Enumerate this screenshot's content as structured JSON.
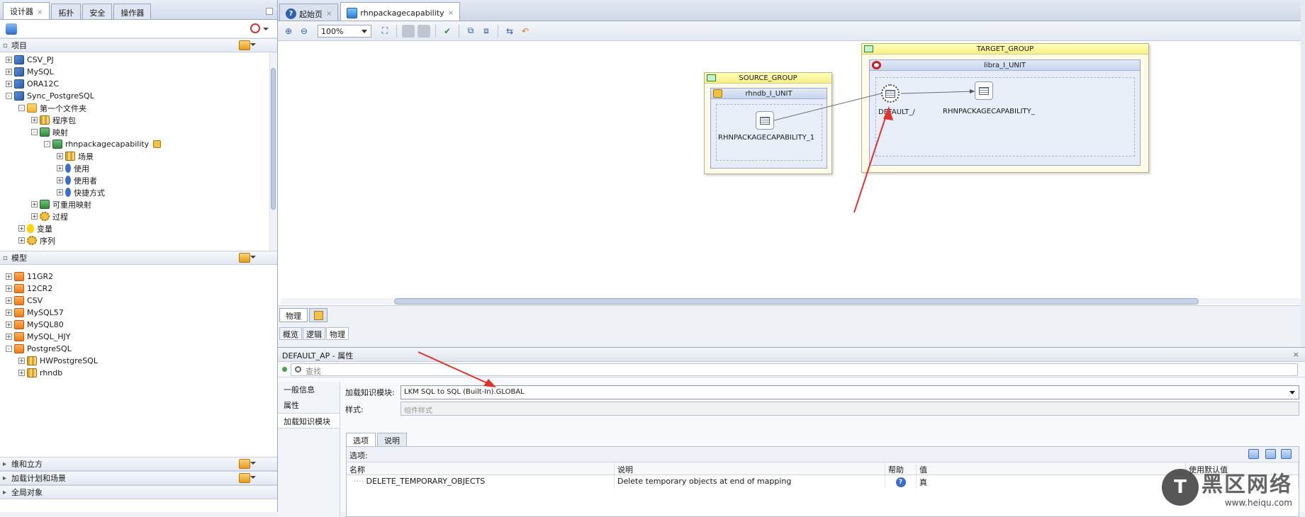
{
  "left_panel": {
    "tabs": [
      "设计器",
      "拓扑",
      "安全",
      "操作器"
    ],
    "section_project": "项目",
    "project_tree": [
      {
        "label": "CSV_PJ",
        "indent": 0,
        "icon": "db",
        "expander": "+"
      },
      {
        "label": "MySQL",
        "indent": 0,
        "icon": "db",
        "expander": "+"
      },
      {
        "label": "ORA12C",
        "indent": 0,
        "icon": "db",
        "expander": "+"
      },
      {
        "label": "Sync_PostgreSQL",
        "indent": 0,
        "icon": "db",
        "expander": "-"
      },
      {
        "label": "第一个文件夹",
        "indent": 1,
        "icon": "fold",
        "expander": "-"
      },
      {
        "label": "程序包",
        "indent": 2,
        "icon": "grid",
        "expander": "+"
      },
      {
        "label": "映射",
        "indent": 2,
        "icon": "map",
        "expander": "-"
      },
      {
        "label": "rhnpackagecapability",
        "indent": 3,
        "icon": "map",
        "expander": "-",
        "locked": true
      },
      {
        "label": "场景",
        "indent": 4,
        "icon": "grid",
        "expander": "+"
      },
      {
        "label": "使用",
        "indent": 4,
        "icon": "pin",
        "expander": "+"
      },
      {
        "label": "使用者",
        "indent": 4,
        "icon": "pin",
        "expander": "+"
      },
      {
        "label": "快捷方式",
        "indent": 4,
        "icon": "pin",
        "expander": "+"
      },
      {
        "label": "可重用映射",
        "indent": 2,
        "icon": "map",
        "expander": "+"
      },
      {
        "label": "过程",
        "indent": 2,
        "icon": "gear",
        "expander": "+"
      },
      {
        "label": "变量",
        "indent": 1,
        "icon": "bulb",
        "expander": "+"
      },
      {
        "label": "序列",
        "indent": 1,
        "icon": "gear",
        "expander": "+"
      }
    ],
    "section_model": "模型",
    "model_tree": [
      {
        "label": "11GR2",
        "indent": 0,
        "icon": "orange",
        "expander": "+"
      },
      {
        "label": "12CR2",
        "indent": 0,
        "icon": "orange",
        "expander": "+"
      },
      {
        "label": "CSV",
        "indent": 0,
        "icon": "orange",
        "expander": "+"
      },
      {
        "label": "MySQL57",
        "indent": 0,
        "icon": "orange",
        "expander": "+"
      },
      {
        "label": "MySQL80",
        "indent": 0,
        "icon": "orange",
        "expander": "+"
      },
      {
        "label": "MySQL_HJY",
        "indent": 0,
        "icon": "orange",
        "expander": "+"
      },
      {
        "label": "PostgreSQL",
        "indent": 0,
        "icon": "orange",
        "expander": "-"
      },
      {
        "label": "HWPostgreSQL",
        "indent": 1,
        "icon": "grid",
        "expander": "+"
      },
      {
        "label": "rhndb",
        "indent": 1,
        "icon": "grid",
        "expander": "+"
      }
    ],
    "bottom_sections": [
      "维和立方",
      "加载计划和场景",
      "全局对象"
    ]
  },
  "editor": {
    "tabs": [
      {
        "label": "起始页",
        "icon": "help-icon"
      },
      {
        "label": "rhnpackagecapability",
        "icon": "mapping-icon"
      }
    ],
    "zoom": "100%",
    "diagram": {
      "target_group": "TARGET_GROUP",
      "source_group": "SOURCE_GROUP",
      "source_unit": "rhndb_I_UNIT",
      "target_unit": "libra_I_UNIT",
      "source_node": "RHNPACKAGECAPABILITY_1",
      "ap_node": "DEFAULT_/",
      "target_node": "RHNPACKAGECAPABILITY_"
    },
    "bottom_tabs": [
      "物理"
    ],
    "sub_tabs": [
      "概览",
      "逻辑",
      "物理"
    ]
  },
  "properties": {
    "title": "DEFAULT_AP - 属性",
    "search_placeholder": "查找",
    "nav": [
      "一般信息",
      "属性",
      "加载知识模块"
    ],
    "lkm_label": "加载知识模块:",
    "lkm_value": "LKM SQL to SQL (Built-In).GLOBAL",
    "style_label": "样式:",
    "style_placeholder": "组件样式",
    "inner_tabs": [
      "选项",
      "说明"
    ],
    "options_label": "选项:",
    "columns": [
      "名称",
      "说明",
      "帮助",
      "值",
      "使用默认值"
    ],
    "rows": [
      {
        "name": "DELETE_TEMPORARY_OBJECTS",
        "desc": "Delete temporary objects at end of mapping",
        "help": "?",
        "value": "真"
      }
    ]
  },
  "watermark": {
    "glyph": "T",
    "text": "黑区网络",
    "url": "www.heiqu.com"
  }
}
